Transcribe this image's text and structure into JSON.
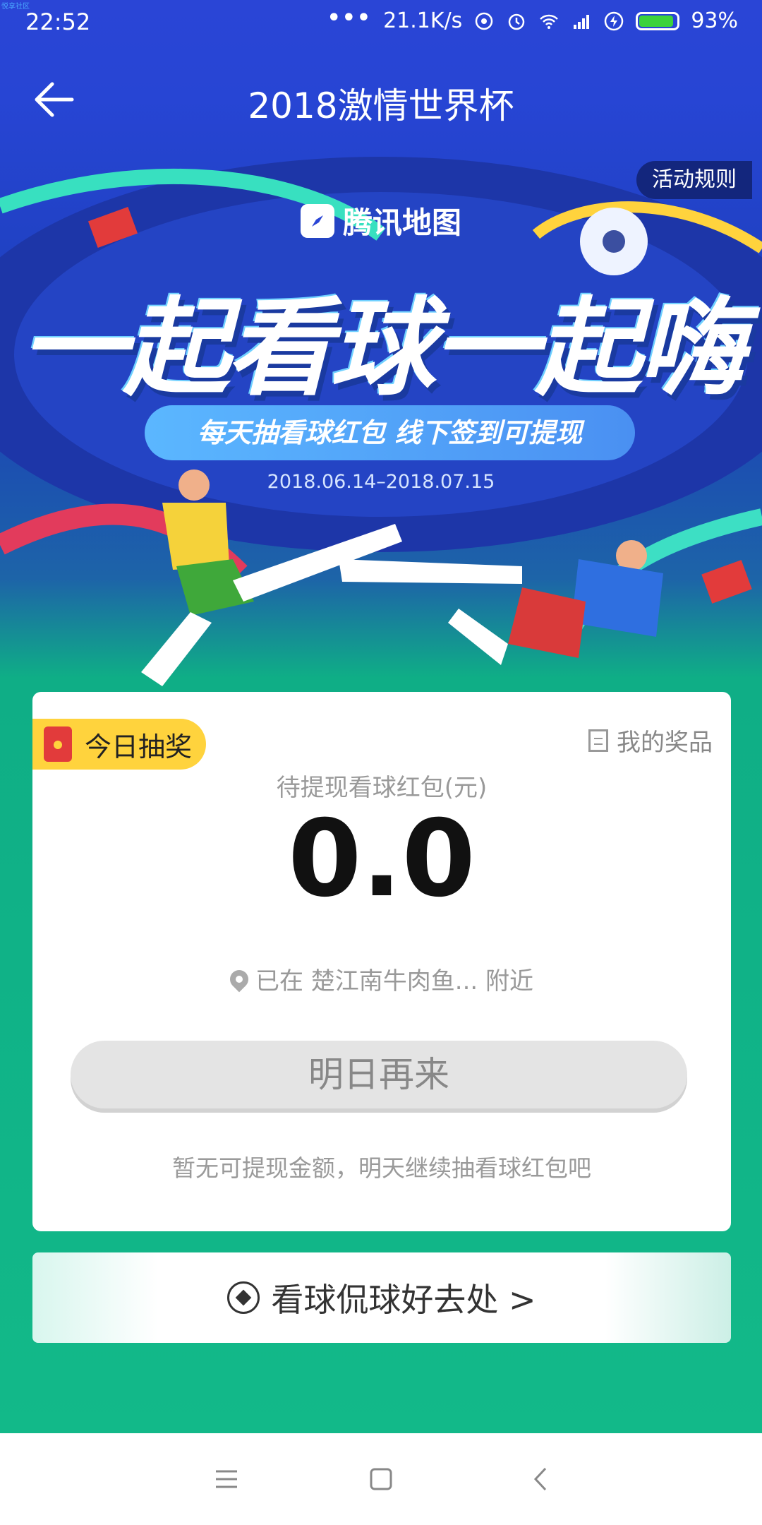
{
  "status_bar": {
    "time": "22:52",
    "network_speed": "21.1K/s",
    "battery_percent": "93%",
    "battery_level": 0.93,
    "watermark": "悦享社区"
  },
  "header": {
    "title": "2018激情世界杯",
    "back_icon": "arrow-left-icon"
  },
  "banner": {
    "rules_label": "活动规则",
    "brand": "腾讯地图",
    "headline": "一起看球一起嗨",
    "subline": "每天抽看球红包 线下签到可提现",
    "date_range": "2018.06.14–2018.07.15"
  },
  "card": {
    "lottery_tag": "今日抽奖",
    "my_prizes": "我的奖品",
    "pending_label": "待提现看球红包(元)",
    "amount": "0.0",
    "location": "已在 楚江南牛肉鱼... 附近",
    "button_label": "明日再来",
    "hint": "暂无可提现金额，明天继续抽看球红包吧"
  },
  "watch_banner": {
    "label": "看球侃球好去处 >"
  },
  "colors": {
    "header_blue": "#2a45d6",
    "green": "#12b989",
    "tag_yellow": "#ffd33d",
    "red_packet": "#e23b3b"
  }
}
